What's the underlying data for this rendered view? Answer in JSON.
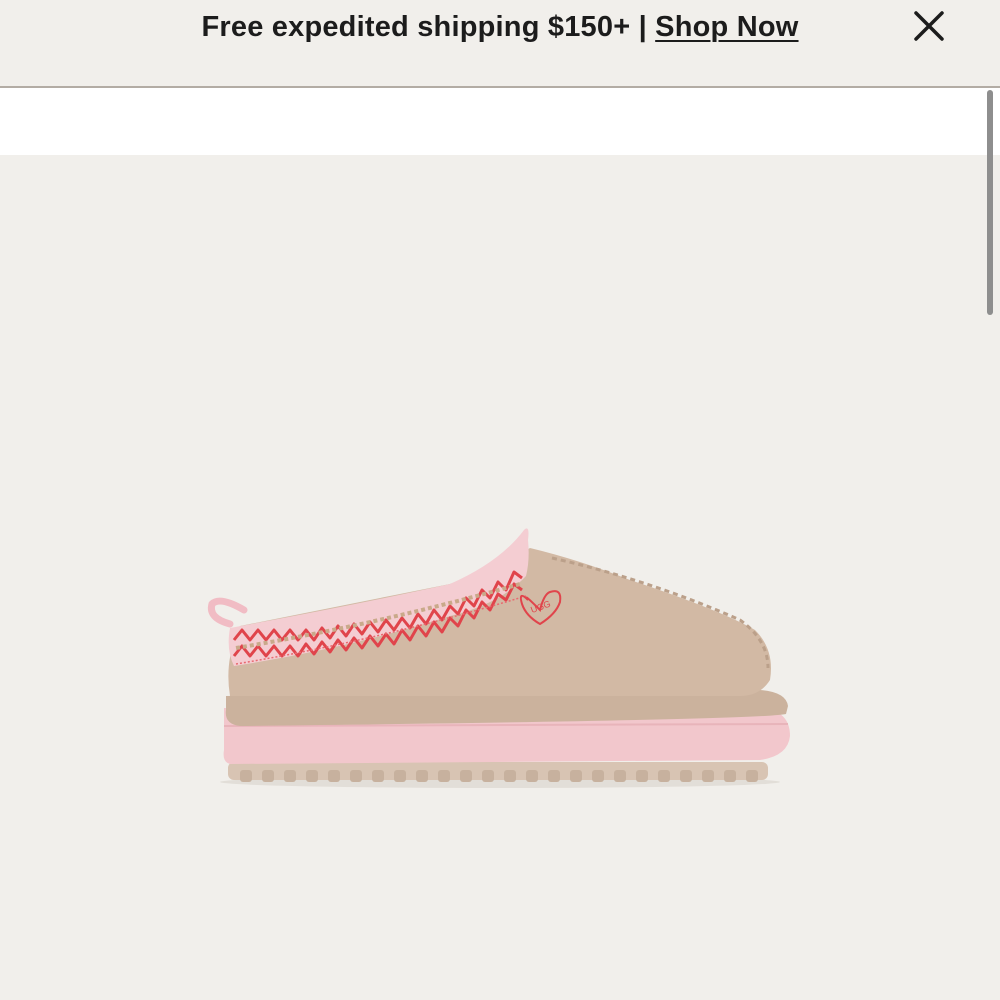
{
  "promo": {
    "text": "Free expedited shipping $150+ | ",
    "link_label": "Shop Now"
  },
  "product": {
    "image_icon": "slipper-image",
    "badge_text": "UGG"
  },
  "colors": {
    "background": "#f1efeb",
    "text": "#1c1c1c",
    "slipper_tan": "#cdb49f",
    "sole_pink": "#f2c7cc",
    "stitch_red": "#e0444b"
  }
}
